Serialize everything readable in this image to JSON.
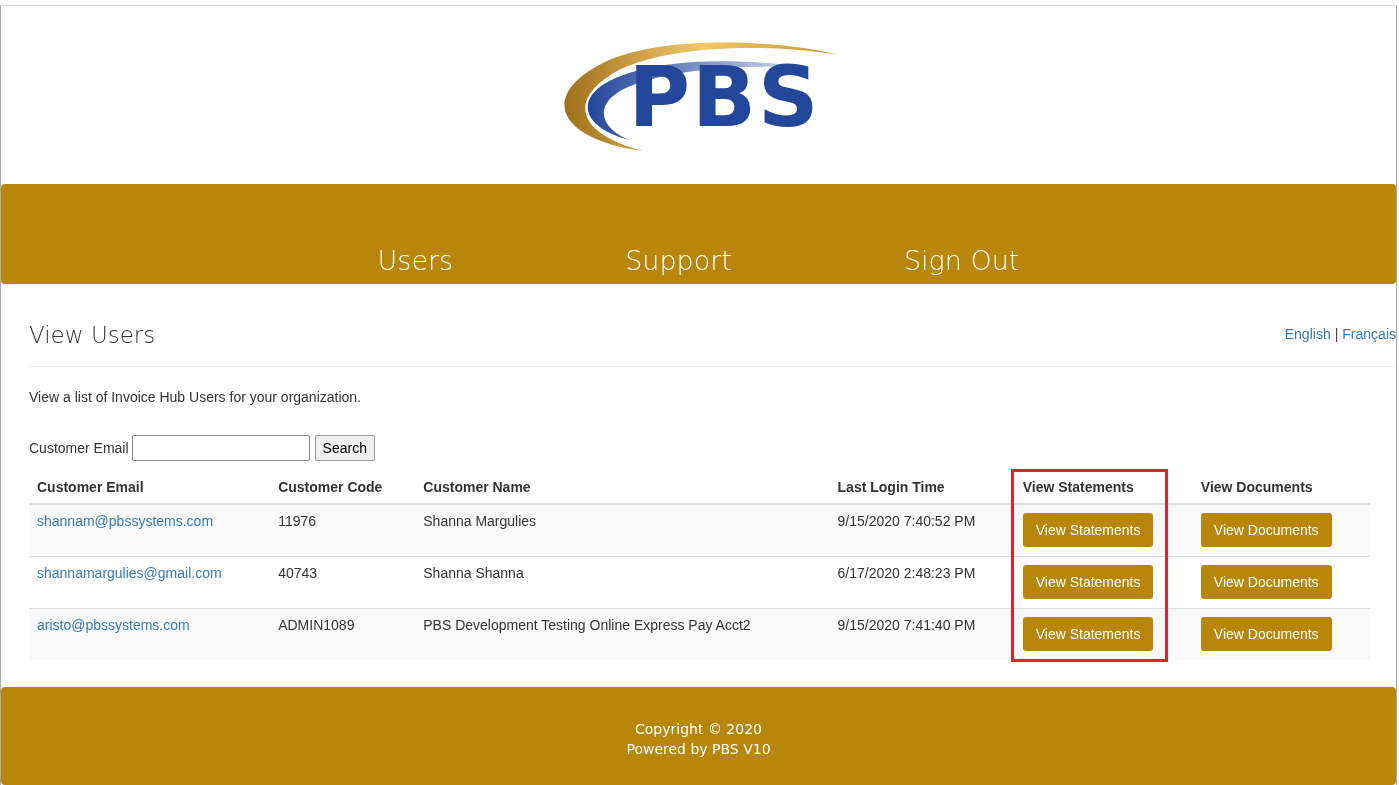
{
  "logo": {
    "text": "PBS"
  },
  "nav": [
    {
      "label": "Users"
    },
    {
      "label": "Support"
    },
    {
      "label": "Sign Out"
    }
  ],
  "page": {
    "title": "View Users",
    "languages": [
      "English",
      "Français"
    ],
    "language_separator": "|",
    "description": "View a list of Invoice Hub Users for your organization."
  },
  "search": {
    "label": "Customer Email",
    "button": "Search"
  },
  "table": {
    "columns": [
      {
        "label": "Customer Email",
        "highlighted": false
      },
      {
        "label": "Customer Code",
        "highlighted": false
      },
      {
        "label": "Customer Name",
        "highlighted": false
      },
      {
        "label": "Last Login Time",
        "highlighted": false
      },
      {
        "label": "View Statements",
        "highlighted": true
      },
      {
        "label": "View Documents",
        "highlighted": false
      }
    ],
    "rows": [
      {
        "email": "shannam@pbssystems.com",
        "code": "11976",
        "name": "Shanna Margulies",
        "last_login": "9/15/2020 7:40:52 PM",
        "statements_button": "View Statements",
        "documents_button": "View Documents"
      },
      {
        "email": "shannamargulies@gmail.com",
        "code": "40743",
        "name": "Shanna Shanna",
        "last_login": "6/17/2020 2:48:23 PM",
        "statements_button": "View Statements",
        "documents_button": "View Documents"
      },
      {
        "email": "aristo@pbssystems.com",
        "code": "ADMIN1089",
        "name": "PBS Development Testing Online Express Pay Acct2",
        "last_login": "9/15/2020 7:41:40 PM",
        "statements_button": "View Statements",
        "documents_button": "View Documents"
      }
    ]
  },
  "footer": {
    "lines": [
      "Copyright © 2020",
      "Powered by PBS V10"
    ]
  }
}
